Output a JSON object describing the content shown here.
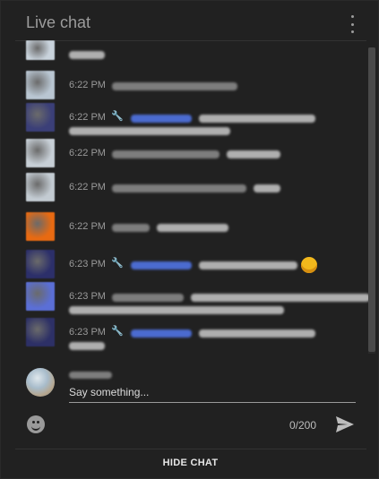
{
  "header": {
    "title": "Live chat"
  },
  "messages": [
    {
      "time": "",
      "avatar_color": "#c9d3dc",
      "wrench": false,
      "author_color": "#7d7d7d",
      "text_lines": 0
    },
    {
      "time": "6:22 PM",
      "avatar_color": "#b9c6d2",
      "wrench": false,
      "author_color": "#7d7d7d",
      "text_lines": 0
    },
    {
      "time": "6:22 PM",
      "avatar_color": "#3b3f78",
      "wrench": true,
      "author_color": "#4b6bd0",
      "text_lines": 2
    },
    {
      "time": "6:22 PM",
      "avatar_color": "#c7cfd6",
      "wrench": false,
      "author_color": "#7d7d7d",
      "text_lines": 0
    },
    {
      "time": "6:22 PM",
      "avatar_color": "#c3cbd2",
      "wrench": false,
      "author_color": "#7d7d7d",
      "text_lines": 0
    },
    {
      "time": "6:22 PM",
      "avatar_color": "#e86a12",
      "wrench": false,
      "author_color": "#7d7d7d",
      "text_lines": 1
    },
    {
      "time": "6:23 PM",
      "avatar_color": "#2c2f6a",
      "wrench": true,
      "author_color": "#4b6bd0",
      "text_lines": 1,
      "emoji": true
    },
    {
      "time": "6:23 PM",
      "avatar_color": "#5b6fd6",
      "wrench": false,
      "author_color": "#7d7d7d",
      "text_lines": 2
    },
    {
      "time": "6:23 PM",
      "avatar_color": "#2d3066",
      "wrench": true,
      "author_color": "#4b6bd0",
      "text_lines": 2
    }
  ],
  "composer": {
    "placeholder": "Say something...",
    "counter": "0/200"
  },
  "footer": {
    "hide_label": "HIDE CHAT"
  },
  "icons": {
    "menu": "more-vert-icon",
    "emoji": "smiley-icon",
    "send": "send-icon",
    "moderator": "wrench-icon"
  },
  "colors": {
    "background": "#212121",
    "moderator_blue": "#5a7bd8",
    "text_muted": "#9a9a9a"
  }
}
